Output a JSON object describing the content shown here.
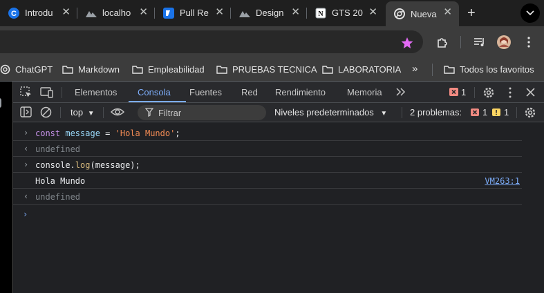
{
  "tabs": [
    {
      "title": "Introdu",
      "icon": "c-logo-icon"
    },
    {
      "title": "localho",
      "icon": "mountain-logo-icon"
    },
    {
      "title": "Pull Re",
      "icon": "coderabbit-logo-icon"
    },
    {
      "title": "Design",
      "icon": "mountain-logo-icon"
    },
    {
      "title": "GTS 20",
      "icon": "notion-logo-icon"
    },
    {
      "title": "Nueva",
      "icon": "chrome-logo-icon"
    }
  ],
  "bookmarks": {
    "items": [
      "ChatGPT",
      "Markdown",
      "Empleabilidad",
      "PRUEBAS TECNICA",
      "LABORATORIA"
    ],
    "overflow": "»",
    "all": "Todos los favoritos"
  },
  "devtools": {
    "tabs": [
      "Elementos",
      "Consola",
      "Fuentes",
      "Red",
      "Rendimiento",
      "Memoria"
    ],
    "active_tab": "Consola",
    "error_count": "1"
  },
  "console_toolbar": {
    "context": "top",
    "filter_placeholder": "Filtrar",
    "levels": "Niveles predeterminados",
    "problems_label": "2 problemas:",
    "problems_errors": "1",
    "problems_warnings": "1"
  },
  "console": {
    "lines": [
      {
        "kind": "input",
        "tokens": [
          {
            "t": "const",
            "c": "kw"
          },
          {
            "t": " "
          },
          {
            "t": "message",
            "c": "vr"
          },
          {
            "t": " = "
          },
          {
            "t": "'Hola Mundo'",
            "c": "str"
          },
          {
            "t": ";"
          }
        ]
      },
      {
        "kind": "result",
        "text": "undefined"
      },
      {
        "kind": "input",
        "tokens": [
          {
            "t": "console"
          },
          {
            "t": "."
          },
          {
            "t": "log",
            "c": "fn"
          },
          {
            "t": "(message);"
          }
        ]
      },
      {
        "kind": "log",
        "text": "Hola Mundo",
        "source": "VM263:1"
      },
      {
        "kind": "result",
        "text": "undefined"
      }
    ]
  },
  "colors": {
    "accent": "#7cacf8",
    "error": "#f28b82",
    "warning": "#fdd663",
    "star": "#e36af5"
  }
}
